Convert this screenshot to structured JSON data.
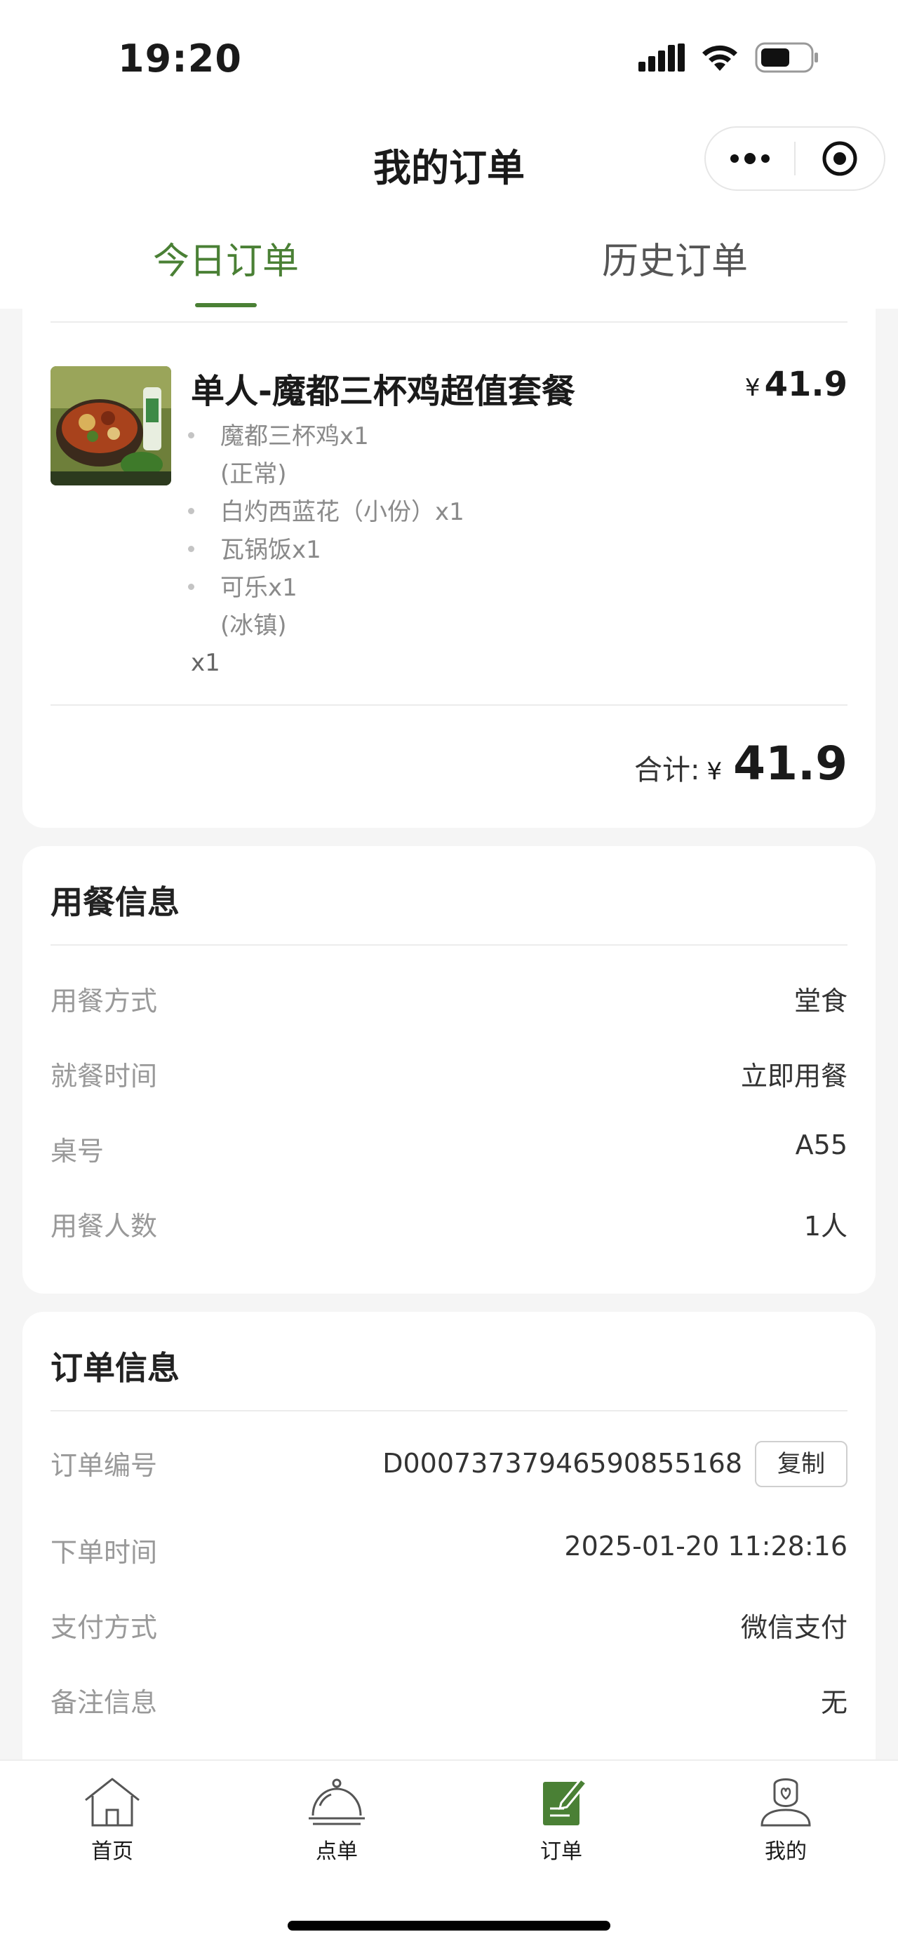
{
  "status_bar": {
    "time": "19:20"
  },
  "nav": {
    "title": "我的订单"
  },
  "tabs": [
    {
      "label": "今日订单",
      "active": true
    },
    {
      "label": "历史订单",
      "active": false
    }
  ],
  "order_item": {
    "name": "单人-魔都三杯鸡超值套餐",
    "currency": "¥",
    "price": "41.9",
    "components": [
      {
        "name": "魔都三杯鸡x1",
        "note": "(正常)"
      },
      {
        "name": "白灼西蓝花（小份）x1",
        "note": ""
      },
      {
        "name": "瓦锅饭x1",
        "note": ""
      },
      {
        "name": "可乐x1",
        "note": "(冰镇)"
      }
    ],
    "quantity": "x1"
  },
  "total": {
    "label": "合计:",
    "currency": "¥",
    "value": "41.9"
  },
  "dining_info": {
    "title": "用餐信息",
    "rows": [
      {
        "label": "用餐方式",
        "value": "堂食"
      },
      {
        "label": "就餐时间",
        "value": "立即用餐"
      },
      {
        "label": "桌号",
        "value": "A55"
      },
      {
        "label": "用餐人数",
        "value": "1人"
      }
    ]
  },
  "order_info": {
    "title": "订单信息",
    "copy_label": "复制",
    "rows": [
      {
        "label": "订单编号",
        "value": "D0007373794659085516​8"
      },
      {
        "label": "下单时间",
        "value": "2025-01-20 11:28:16"
      },
      {
        "label": "支付方式",
        "value": "微信支付"
      },
      {
        "label": "备注信息",
        "value": "无"
      }
    ]
  },
  "bottom_nav": [
    {
      "label": "首页",
      "icon": "home-icon",
      "active": false
    },
    {
      "label": "点单",
      "icon": "cloche-icon",
      "active": false
    },
    {
      "label": "订单",
      "icon": "order-note-icon",
      "active": true
    },
    {
      "label": "我的",
      "icon": "profile-icon",
      "active": false
    }
  ],
  "colors": {
    "accent": "#4a8035",
    "background": "#f5f5f5"
  }
}
